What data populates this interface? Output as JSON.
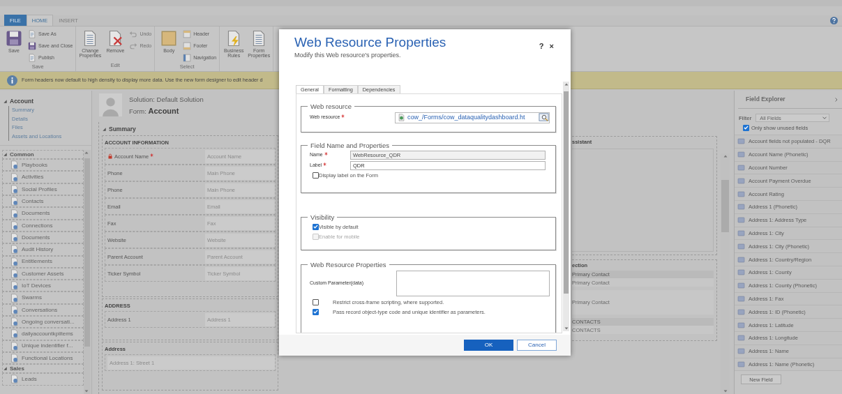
{
  "app_tabs": [
    {
      "label": "FILE",
      "kind": "file",
      "selected": false
    },
    {
      "label": "HOME",
      "kind": "tab",
      "selected": true
    },
    {
      "label": "INSERT",
      "kind": "tab",
      "selected": false
    }
  ],
  "ribbon_groups": [
    {
      "label": "Save",
      "buttons": [
        {
          "label": "Save",
          "kind": "large",
          "disabled": false
        },
        {
          "label": "Save As",
          "kind": "small",
          "disabled": false
        },
        {
          "label": "Save and Close",
          "kind": "small",
          "disabled": false
        },
        {
          "label": "Publish",
          "kind": "small",
          "disabled": false
        }
      ]
    },
    {
      "label": "Edit",
      "buttons": [
        {
          "label": "Change Properties",
          "kind": "large",
          "disabled": false
        },
        {
          "label": "Remove",
          "kind": "large",
          "disabled": false
        },
        {
          "label": "Undo",
          "kind": "small",
          "disabled": true
        },
        {
          "label": "Redo",
          "kind": "small",
          "disabled": true
        }
      ]
    },
    {
      "label": "Select",
      "buttons": [
        {
          "label": "Body",
          "kind": "large",
          "disabled": false
        },
        {
          "label": "Header",
          "kind": "small",
          "disabled": false
        },
        {
          "label": "Footer",
          "kind": "small",
          "disabled": false
        },
        {
          "label": "Navigation",
          "kind": "small",
          "disabled": false
        }
      ]
    },
    {
      "buttons": [
        {
          "label": "Business Rules",
          "kind": "large",
          "disabled": false
        },
        {
          "label": "Form Properties",
          "kind": "large",
          "disabled": false
        }
      ]
    }
  ],
  "notice": "Form headers now default to high density to display more data. Use the new form designer to edit header d",
  "nav_tree": {
    "label": "Account",
    "expanded": true,
    "children": [
      {
        "label": "Summary"
      },
      {
        "label": "Details"
      },
      {
        "label": "Files"
      },
      {
        "label": "Assets and Locations"
      }
    ]
  },
  "nav_groups": [
    {
      "label": "Common",
      "expanded": true,
      "items": [
        "Playbooks",
        "Activities",
        "Social Profiles",
        "Contacts",
        "Documents",
        "Connections",
        "Documents",
        "Audit History",
        "Entitlements",
        "Customer Assets",
        "IoT Devices",
        "Swarms",
        "Conversations",
        "Ongoing conversati...",
        "dailyaccountkpiitems",
        "Unique indentifier f...",
        "Functional Locations"
      ]
    },
    {
      "label": "Sales",
      "expanded": true,
      "items": [
        "Leads"
      ]
    }
  ],
  "form_header": {
    "solution": "Solution: Default Solution",
    "form": "Form: **Account**"
  },
  "summary_tab": {
    "label": "Summary",
    "expanded": true,
    "sections": [
      {
        "title": "ACCOUNT INFORMATION",
        "rows": [
          {
            "label": "Account Name",
            "required": true,
            "locked": true,
            "placeholder": "Account Name"
          },
          {
            "label": "Phone",
            "required": false,
            "locked": false,
            "placeholder": "Main Phone"
          },
          {
            "label": "Phone",
            "required": false,
            "locked": false,
            "placeholder": "Main Phone"
          },
          {
            "label": "Email",
            "required": false,
            "locked": false,
            "placeholder": "Email"
          },
          {
            "label": "Fax",
            "required": false,
            "locked": false,
            "placeholder": "Fax"
          },
          {
            "label": "Website",
            "required": false,
            "locked": false,
            "placeholder": "Website"
          },
          {
            "label": "Parent Account",
            "required": false,
            "locked": false,
            "placeholder": "Parent Account"
          },
          {
            "label": "Ticker Symbol",
            "required": false,
            "locked": false,
            "placeholder": "Ticker Symbol"
          }
        ]
      },
      {
        "title": "ADDRESS",
        "rows": [
          {
            "label": "Address 1",
            "required": false,
            "locked": false,
            "placeholder": "Address 1"
          }
        ]
      },
      {
        "title": "Address",
        "rows": [
          {
            "required": false,
            "locked": false,
            "placeholder": "Address 1: Street 1"
          }
        ]
      }
    ]
  },
  "side_sections": [
    {
      "title": "ssistant",
      "kind": "block"
    },
    {
      "title": "ection",
      "kind": "fields",
      "fields": [
        {
          "label": "Primary Contact",
          "placeholder": "Primary Contact"
        },
        {
          "placeholder": "Primary Contact"
        },
        {
          "label": "CONTACTS",
          "placeholder": "CONTACTS"
        }
      ]
    }
  ],
  "field_explorer": {
    "title": "Field Explorer",
    "filter_label": "Filter",
    "filter_value": "All Fields",
    "unused_label": "Only show unused fields",
    "unused_checked": true,
    "fields": [
      "Account fields not populated - DQR",
      "Account Name (Phonetic)",
      "Account Number",
      "Account Payment Overdue",
      "Account Rating",
      "Address 1 (Phonetic)",
      "Address 1: Address Type",
      "Address 1: City",
      "Address 1: City (Phonetic)",
      "Address 1: Country/Region",
      "Address 1: County",
      "Address 1: County (Phonetic)",
      "Address 1: Fax",
      "Address 1: ID (Phonetic)",
      "Address 1: Latitude",
      "Address 1: Longitude",
      "Address 1: Name",
      "Address 1: Name (Phonetic)"
    ],
    "new_field": "New Field"
  },
  "dialog": {
    "title": "Web Resource Properties",
    "subtitle": "Modify this Web resource's properties.",
    "help": "?",
    "close": "×",
    "tabs": [
      {
        "label": "General",
        "selected": true
      },
      {
        "label": "Formatting",
        "selected": false
      },
      {
        "label": "Dependencies",
        "selected": false
      }
    ],
    "web_resource": {
      "legend": "Web resource",
      "label": "Web resource",
      "required": true,
      "value": "cow_/Forms/cow_dataqualitydashboard.ht"
    },
    "field_name": {
      "legend": "Field Name and Properties",
      "fields": [
        {
          "label": "Name",
          "value": "WebResource_QDR",
          "required": true,
          "disabled": true
        },
        {
          "label": "Label",
          "value": "QDR",
          "required": true,
          "disabled": false
        }
      ],
      "display_label": {
        "label": "Display label on the Form",
        "checked": false
      }
    },
    "visibility": {
      "legend": "Visibility",
      "options": [
        {
          "label": "Visible by default",
          "checked": true,
          "disabled": false
        },
        {
          "label": "Enable for mobile",
          "checked": false,
          "disabled": true
        }
      ]
    },
    "properties": {
      "legend": "Web Resource Properties",
      "param_label": "Custom Parameter(data)",
      "options": [
        {
          "label": "Restrict cross-frame scripting, where supported.",
          "checked": false
        },
        {
          "label": "Pass record object-type code and unique identifier as parameters.",
          "checked": true
        }
      ]
    },
    "buttons": [
      {
        "label": "OK",
        "kind": "primary"
      },
      {
        "label": "Cancel",
        "kind": "secondary"
      }
    ]
  }
}
